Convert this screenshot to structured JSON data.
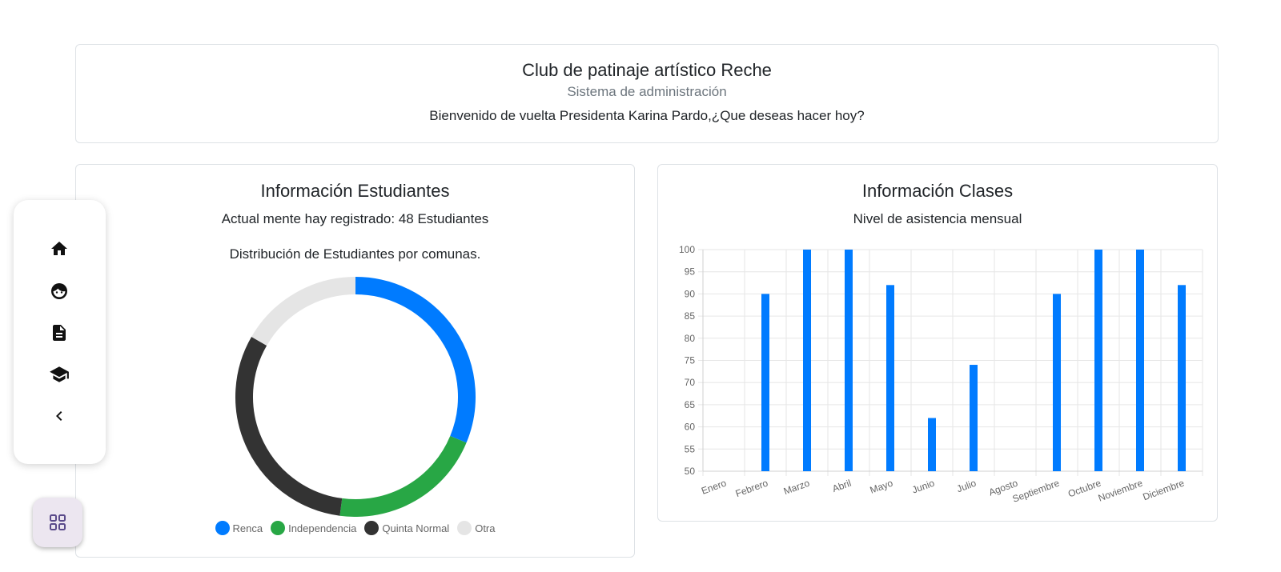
{
  "header": {
    "title": "Club de patinaje artístico Reche",
    "subtitle": "Sistema de administración",
    "welcome": "Bienvenido de vuelta Presidenta Karina Pardo,¿Que deseas hacer hoy?"
  },
  "students": {
    "title": "Información Estudiantes",
    "count_text": "Actual mente hay registrado: 48 Estudiantes",
    "distribution_text": "Distribución de Estudiantes por comunas."
  },
  "classes": {
    "title": "Información Clases",
    "subtitle": "Nivel de asistencia mensual"
  },
  "nav": {
    "items": [
      {
        "icon": "home-icon"
      },
      {
        "icon": "face-icon"
      },
      {
        "icon": "document-icon"
      },
      {
        "icon": "graduation-cap-icon"
      },
      {
        "icon": "chevron-left-icon"
      }
    ],
    "fab_icon": "grid-icon"
  },
  "chart_data": [
    {
      "type": "pie",
      "variant": "donut",
      "categories": [
        "Renca",
        "Independencia",
        "Quinta Normal",
        "Otra"
      ],
      "values": [
        15,
        10,
        15,
        8
      ],
      "colors": [
        "#007bff",
        "#28a745",
        "#333333",
        "#e5e5e5"
      ],
      "legend": "bottom"
    },
    {
      "type": "bar",
      "categories": [
        "Enero",
        "Febrero",
        "Marzo",
        "Abril",
        "Mayo",
        "Junio",
        "Julio",
        "Agosto",
        "Septiembre",
        "Octubre",
        "Noviembre",
        "Diciembre"
      ],
      "values": [
        null,
        90,
        100,
        100,
        92,
        62,
        74,
        null,
        90,
        100,
        100,
        92
      ],
      "ylim": [
        50,
        100
      ],
      "yticks": [
        50,
        55,
        60,
        65,
        70,
        75,
        80,
        85,
        90,
        95,
        100
      ],
      "color": "#007bff",
      "grid": true,
      "xlabel": "",
      "ylabel": ""
    }
  ]
}
